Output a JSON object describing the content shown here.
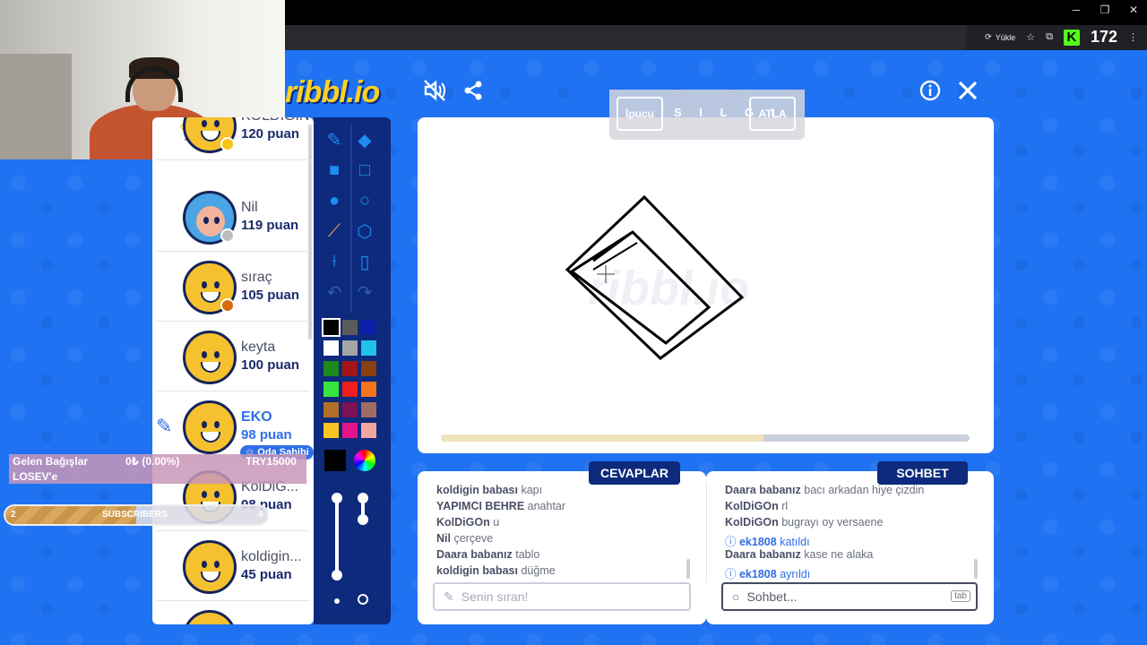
{
  "browser": {
    "yukle_label": "Yükle",
    "kick_count": "172"
  },
  "logo_text": "ribbl.io",
  "word_bar": {
    "hint_label": "İpucu",
    "word": "S I L G I",
    "skip_label": "ATLA"
  },
  "players": [
    {
      "name": "KOLDİGİN MC...",
      "score": "120 puan",
      "rank": "1",
      "dot": "#f5c518"
    },
    {
      "name": "Nil",
      "score": "119 puan",
      "dot": "#bdbdbd"
    },
    {
      "name": "sıraç",
      "score": "105 puan",
      "dot": "#d86a12"
    },
    {
      "name": "keyta",
      "score": "100 puan"
    },
    {
      "name": "EKO",
      "score": "98 puan",
      "badge": "Oda Sahibi"
    },
    {
      "name": "KolDiG...",
      "score": "98 puan"
    },
    {
      "name": "koldigin...",
      "score": "45 puan"
    }
  ],
  "tabs": {
    "answers": "CEVAPLAR",
    "chat": "SOHBET"
  },
  "answers": [
    {
      "user": "koldigin babası",
      "text": "kapı"
    },
    {
      "user": "YAPIMCI BEHRE",
      "text": "anahtar"
    },
    {
      "user": "KolDiGOn",
      "text": "u"
    },
    {
      "user": "Nil",
      "text": "çerçeve"
    },
    {
      "user": "Daara babanız",
      "text": "tablo"
    },
    {
      "user": "koldigin babası",
      "text": "düğme"
    }
  ],
  "chat": [
    {
      "user": "Daara babanız",
      "text": "bacı arkadan hiye çizdin"
    },
    {
      "user": "KolDiGOn",
      "text": "rl"
    },
    {
      "user": "KolDiGOn",
      "text": "bugrayı oy versaene"
    },
    {
      "user": "ek1808",
      "text": "katıldı",
      "system": true
    },
    {
      "user": "Daara babanız",
      "text": "kase ne alaka"
    },
    {
      "user": "ek1808",
      "text": "ayrıldı",
      "system": true
    }
  ],
  "answer_input_placeholder": "Senin sıran!",
  "chat_input_placeholder": "Sohbet...",
  "tab_key": "tab",
  "timer_fraction": 0.61,
  "donation": {
    "title": "Gelen Bağışlar",
    "amount": "0₺ (0.00%)",
    "goal": "TRY15000",
    "org": "LOSEV'e"
  },
  "subs": {
    "left": "2",
    "label": "SUBSCRIBERS",
    "right": "4",
    "fraction": 0.5
  },
  "palette": [
    [
      "#000000",
      "#5b5b5b",
      "#0d1ea8"
    ],
    [
      "#ffffff",
      "#a6a6a6",
      "#21c1ea"
    ],
    [
      "#1c8a1c",
      "#a21616",
      "#8a3f0f"
    ],
    [
      "#39e53d",
      "#ee1f1f",
      "#f6731c"
    ],
    [
      "#b26f27",
      "#7e1153",
      "#9f6b63"
    ],
    [
      "#f8c525",
      "#e4138a",
      "#f1a6a0"
    ]
  ],
  "icons": {
    "mute": "mute-icon",
    "share": "share-icon",
    "info": "info-icon",
    "close": "close-icon"
  }
}
